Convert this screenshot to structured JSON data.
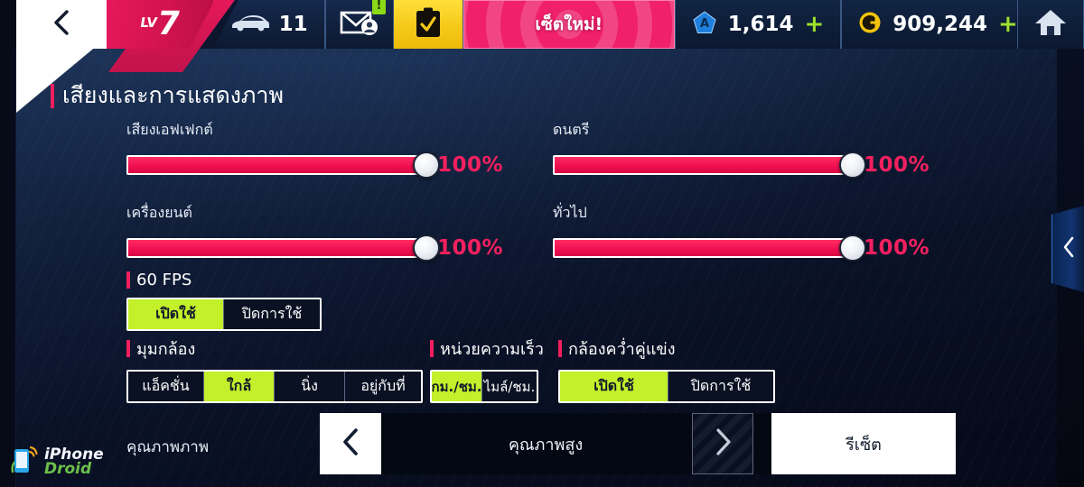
{
  "topbar": {
    "back_icon": "chevron-left-icon",
    "level": {
      "prefix": "LV",
      "value": "7"
    },
    "garage": {
      "icon": "car-icon",
      "count": "11"
    },
    "mail": {
      "icon": "mail-icon",
      "badge": "!"
    },
    "tasks": {
      "icon": "clipboard-check-icon"
    },
    "banner": {
      "label": "เซ็ตใหม่!"
    },
    "tokens": {
      "icon": "token-pentagon-icon",
      "value": "1,614",
      "add": "+"
    },
    "credits": {
      "icon": "credit-coin-icon",
      "value": "909,244",
      "add": "+"
    },
    "home": {
      "icon": "home-icon"
    }
  },
  "page": {
    "title": "เสียงและการแสดงภาพ"
  },
  "sliders": [
    {
      "label": "เสียงเอฟเฟกต์",
      "value": "100%",
      "percent": 100
    },
    {
      "label": "ดนตรี",
      "value": "100%",
      "percent": 100
    },
    {
      "label": "เครื่องยนต์",
      "value": "100%",
      "percent": 100
    },
    {
      "label": "ทั่วไป",
      "value": "100%",
      "percent": 100
    }
  ],
  "fps": {
    "title": "60 FPS",
    "options": [
      {
        "label": "เปิดใช้",
        "selected": true
      },
      {
        "label": "ปิดการใช้",
        "selected": false
      }
    ]
  },
  "camera_angle": {
    "title": "มุมกล้อง",
    "options": [
      {
        "label": "แอ็คชั่น",
        "selected": false
      },
      {
        "label": "ใกล้",
        "selected": true
      },
      {
        "label": "นิ่ง",
        "selected": false
      },
      {
        "label": "อยู่กับที่",
        "selected": false
      }
    ]
  },
  "speed_unit": {
    "title": "หน่วยความเร็ว",
    "options": [
      {
        "label": "กม./ชม.",
        "selected": true
      },
      {
        "label": "ไมล์/ชม.",
        "selected": false
      }
    ]
  },
  "takedown_camera": {
    "title": "กล้องคว่ำคู่แข่ง",
    "options": [
      {
        "label": "เปิดใช้",
        "selected": true
      },
      {
        "label": "ปิดการใช้",
        "selected": false
      }
    ]
  },
  "quality": {
    "label": "คุณภาพภาพ",
    "value": "คุณภาพสูง",
    "prev_icon": "chevron-left-icon",
    "next_icon": "chevron-right-icon",
    "next_disabled": true,
    "reset_label": "รีเซ็ต"
  },
  "edge_tab": {
    "icon": "chevron-left-icon"
  },
  "watermark": {
    "line1": "iPhone",
    "line2": "Droid"
  },
  "colors": {
    "accent_pink": "#ef1e5e",
    "slider_fill": "#f00d50",
    "selected_green": "#c2f02a",
    "plus_green": "#9ee02c",
    "panel_navy": "#16294a",
    "gold": "#f5c91a"
  }
}
